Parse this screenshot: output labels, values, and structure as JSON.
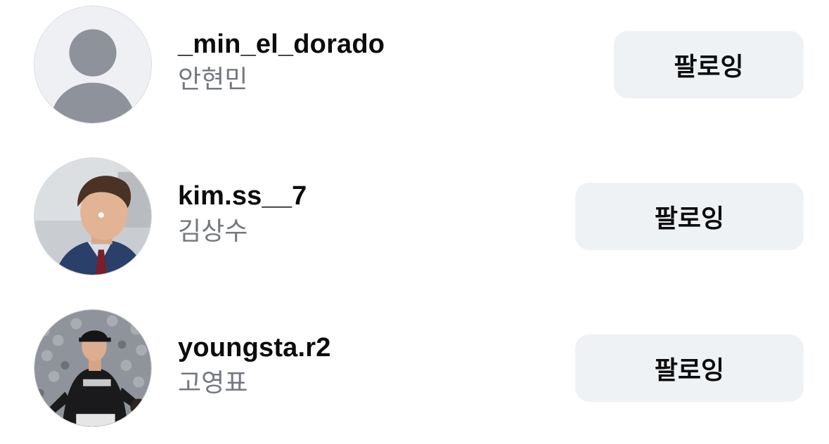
{
  "follow_list": [
    {
      "username": "_min_el_dorado",
      "full_name": "안현민",
      "button_label": "팔로잉",
      "avatar": "default-profile-icon"
    },
    {
      "username": "kim.ss__7",
      "full_name": "김상수",
      "button_label": "팔로잉",
      "avatar": "profile-photo"
    },
    {
      "username": "youngsta.r2",
      "full_name": "고영표",
      "button_label": "팔로잉",
      "avatar": "profile-photo"
    }
  ],
  "colors": {
    "button_bg": "#eff2f5",
    "username": "#0c0c0c",
    "full_name": "#737880",
    "default_avatar_bg": "#eef0f3",
    "default_avatar_fg": "#8e939b"
  }
}
